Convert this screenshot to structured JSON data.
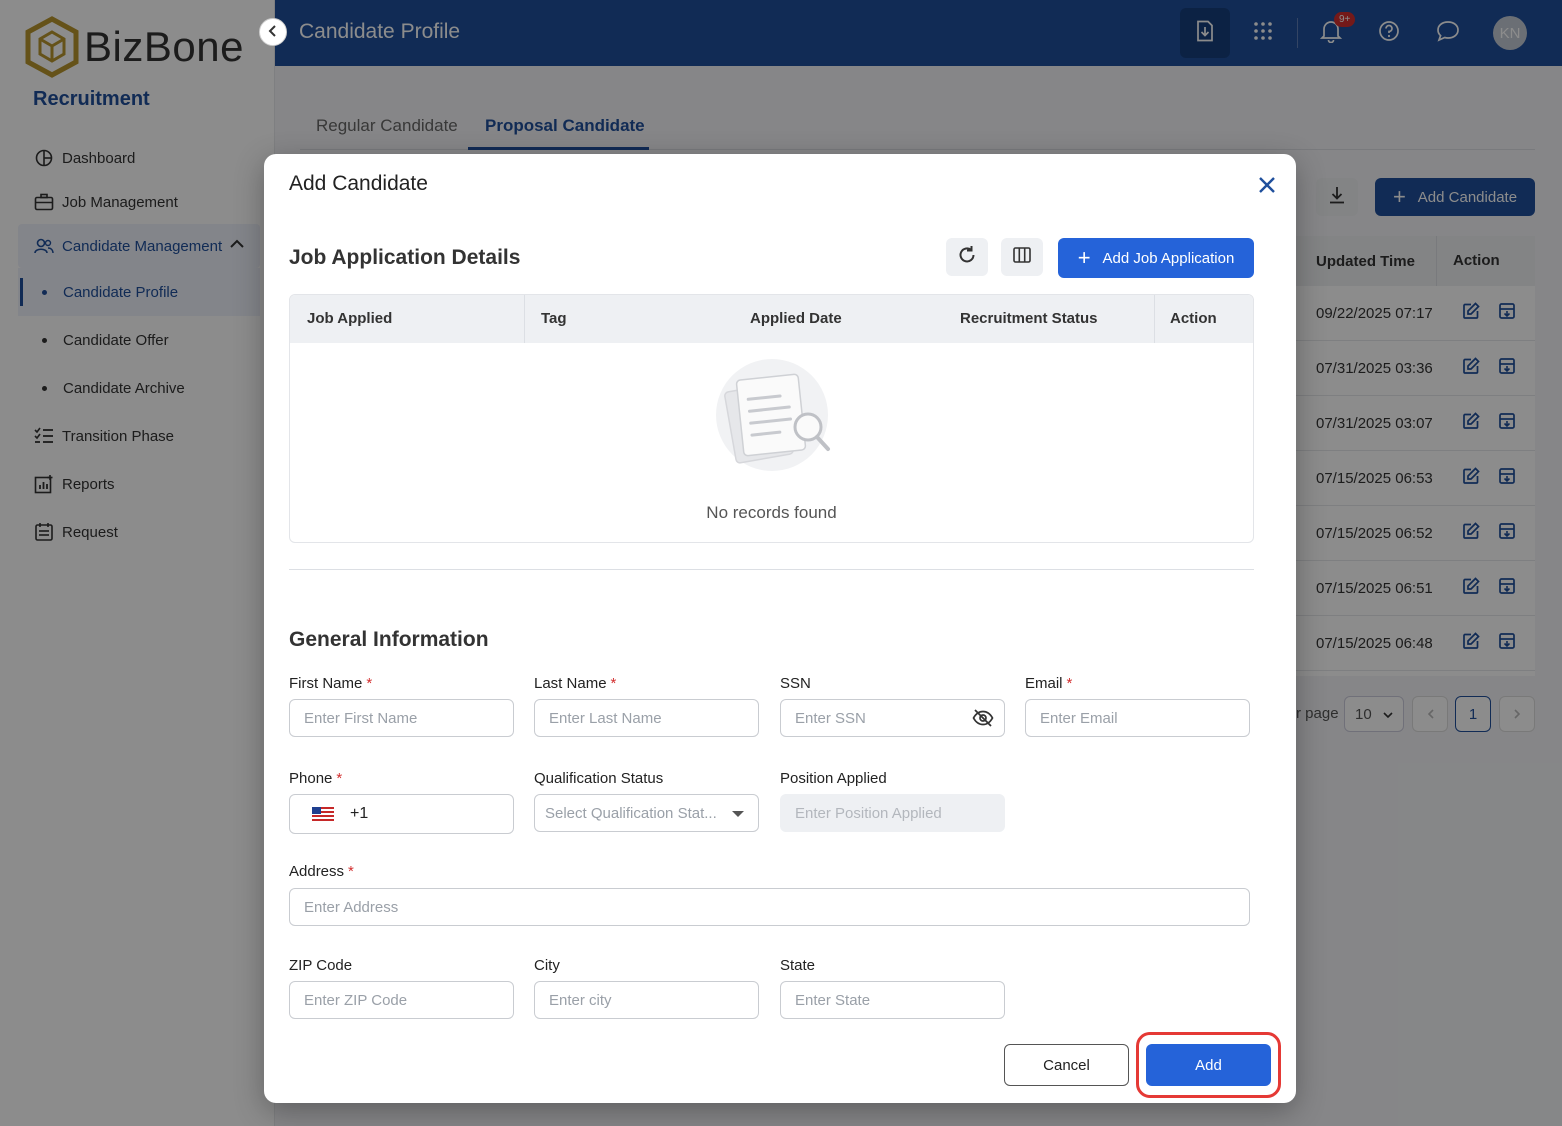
{
  "brand": {
    "logo_text": "BizBone",
    "app_name": "Recruitment"
  },
  "header": {
    "title": "Candidate Profile",
    "notification_badge": "9+",
    "avatar_initials": "KN"
  },
  "sidebar": {
    "items": [
      {
        "label": "Dashboard"
      },
      {
        "label": "Job Management"
      },
      {
        "label": "Candidate Management"
      },
      {
        "label": "Candidate Profile"
      },
      {
        "label": "Candidate Offer"
      },
      {
        "label": "Candidate Archive"
      },
      {
        "label": "Transition Phase"
      },
      {
        "label": "Reports"
      },
      {
        "label": "Request"
      }
    ]
  },
  "tabs": [
    {
      "label": "Regular Candidate"
    },
    {
      "label": "Proposal Candidate"
    }
  ],
  "background": {
    "add_candidate_label": "Add Candidate",
    "columns": [
      "Updated Time",
      "Action"
    ],
    "rows": [
      "09/22/2025 07:17",
      "07/31/2025 03:36",
      "07/31/2025 03:07",
      "07/15/2025 06:53",
      "07/15/2025 06:52",
      "07/15/2025 06:51",
      "07/15/2025 06:48"
    ],
    "per_page_label": "r page",
    "per_page_value": "10",
    "current_page": "1"
  },
  "modal": {
    "title": "Add Candidate",
    "job_section": {
      "title": "Job Application Details",
      "add_button": "Add Job Application",
      "columns": [
        "Job Applied",
        "Tag",
        "Applied Date",
        "Recruitment Status",
        "Action"
      ],
      "empty_text": "No records found"
    },
    "general_section": {
      "title": "General Information",
      "first_name": {
        "label": "First Name",
        "placeholder": "Enter First Name"
      },
      "last_name": {
        "label": "Last Name",
        "placeholder": "Enter Last Name"
      },
      "ssn": {
        "label": "SSN",
        "placeholder": "Enter SSN"
      },
      "email": {
        "label": "Email",
        "placeholder": "Enter Email"
      },
      "phone": {
        "label": "Phone",
        "value": "+1"
      },
      "qualification": {
        "label": "Qualification Status",
        "placeholder": "Select Qualification Stat..."
      },
      "position": {
        "label": "Position Applied",
        "placeholder": "Enter Position Applied"
      },
      "address": {
        "label": "Address",
        "placeholder": "Enter Address"
      },
      "zip": {
        "label": "ZIP Code",
        "placeholder": "Enter ZIP Code"
      },
      "city": {
        "label": "City",
        "placeholder": "Enter city"
      },
      "state": {
        "label": "State",
        "placeholder": "Enter State"
      },
      "required_mark": "*"
    },
    "cancel_label": "Cancel",
    "add_label": "Add"
  },
  "colors": {
    "primary": "#1f4f9c",
    "button": "#2563d9",
    "highlight": "#e53935"
  }
}
